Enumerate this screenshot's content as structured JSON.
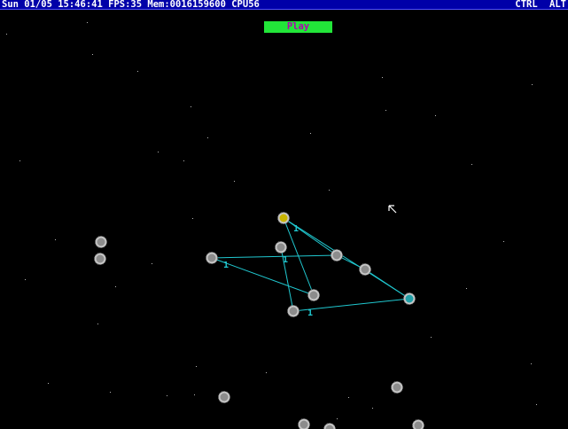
{
  "status_bar": {
    "datetime": "Sun 01/05 15:46:41",
    "fps": "FPS:35",
    "memory": "Mem:0016159600",
    "cpu": "CPU56",
    "modifier_keys": [
      "CTRL",
      "ALT"
    ]
  },
  "play_button": {
    "label": "Play"
  },
  "colors": {
    "status_bar_bg": "#0000a8",
    "play_button_bg": "#22e639",
    "play_button_text": "#b000b0",
    "link_line": "#20c8d0",
    "node_gray": "#8c8c8c",
    "node_selected": "#c8b400",
    "node_cyan": "#20a0a8",
    "background": "#000000"
  },
  "graph": {
    "link_weights": [
      "1",
      "1",
      "1",
      "1"
    ]
  },
  "icons": {
    "cursor": "mouse-pointer-icon"
  }
}
